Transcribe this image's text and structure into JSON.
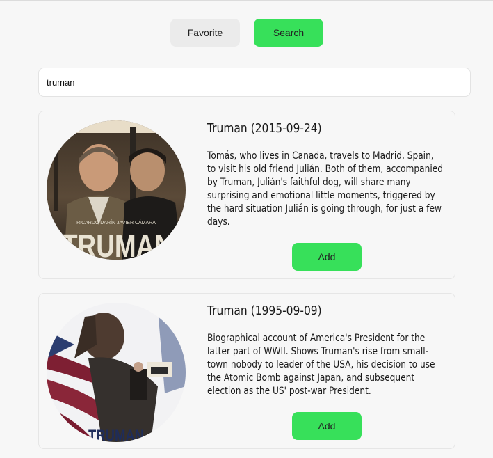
{
  "tabs": {
    "favorite_label": "Favorite",
    "search_label": "Search"
  },
  "search": {
    "value": "truman"
  },
  "results": [
    {
      "title": "Truman (2015-09-24)",
      "description": "Tomás, who lives in Canada, travels to Madrid, Spain, to visit his old friend Julián. Both of them, accompanied by Truman, Julián's faithful dog, will share many surprising and emotional little moments, triggered by the hard situation Julián is going through, for just a few days.",
      "add_label": "Add",
      "poster_text": "TRUMAN",
      "poster_credits": "RICARDO DARÍN   JAVIER CÁMARA"
    },
    {
      "title": "Truman (1995-09-09)",
      "description": "Biographical account of America's President for the latter part of WWII. Shows Truman's rise from small-town nobody to leader of the USA, his decision to use the Atomic Bomb against Japan, and subsequent election as the US' post-war President.",
      "add_label": "Add",
      "poster_text": "TRUMAN"
    }
  ]
}
